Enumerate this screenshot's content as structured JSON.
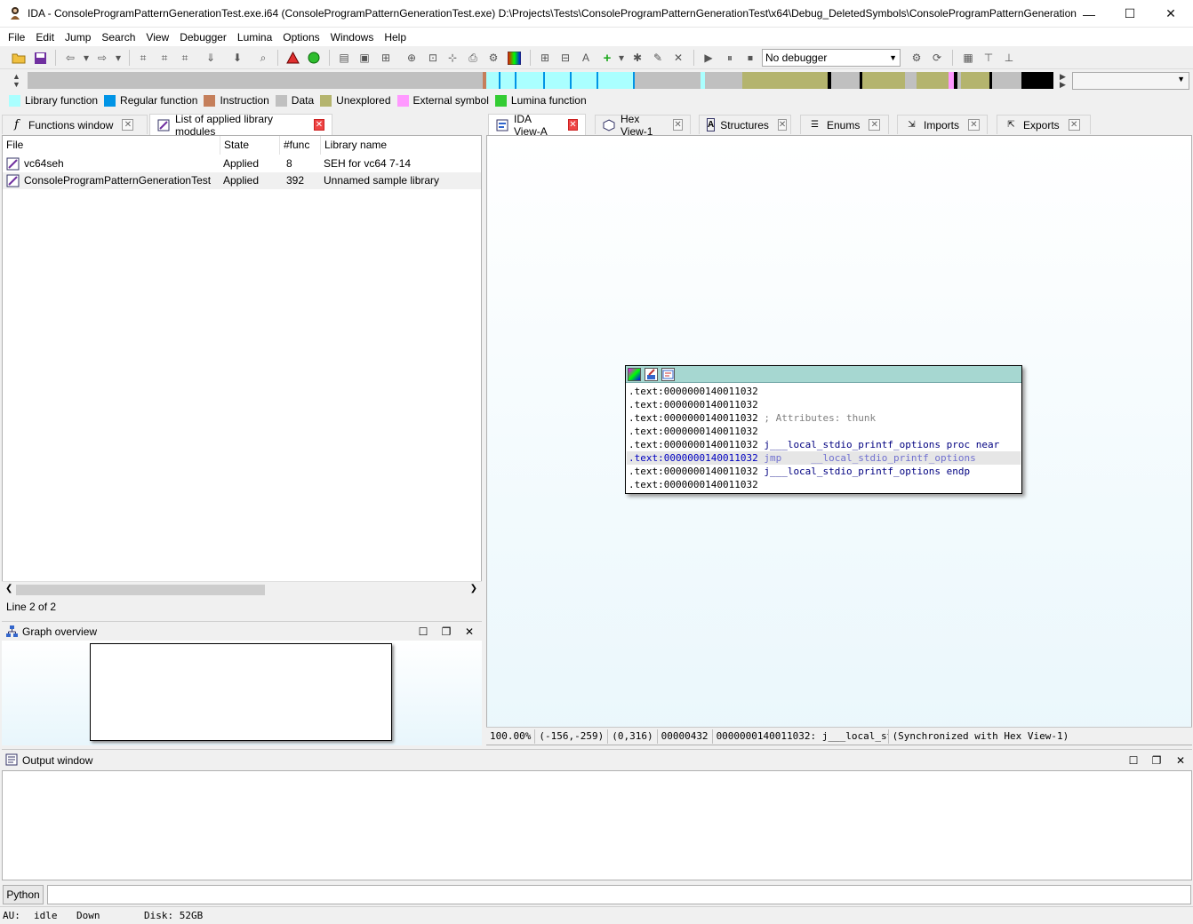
{
  "window": {
    "title": "IDA - ConsoleProgramPatternGenerationTest.exe.i64 (ConsoleProgramPatternGenerationTest.exe) D:\\Projects\\Tests\\ConsoleProgramPatternGenerationTest\\x64\\Debug_DeletedSymbols\\ConsoleProgramPatternGenerationT...",
    "minimize": "—",
    "maximize": "☐",
    "close": "✕"
  },
  "menu": [
    "File",
    "Edit",
    "Jump",
    "Search",
    "View",
    "Debugger",
    "Lumina",
    "Options",
    "Windows",
    "Help"
  ],
  "toolbar": {
    "debugger": "No debugger"
  },
  "legend": [
    {
      "label": "Library function",
      "color": "#aaffff"
    },
    {
      "label": "Regular function",
      "color": "#0094e6"
    },
    {
      "label": "Instruction",
      "color": "#c57f5b"
    },
    {
      "label": "Data",
      "color": "#c0c0c0"
    },
    {
      "label": "Unexplored",
      "color": "#b4b46e"
    },
    {
      "label": "External symbol",
      "color": "#ff99ff"
    },
    {
      "label": "Lumina function",
      "color": "#33cc33"
    }
  ],
  "left_tabs": [
    {
      "label": "Functions window",
      "icon": "function-icon"
    },
    {
      "label": "List of applied library modules",
      "icon": "library-icon"
    }
  ],
  "right_tabs": [
    {
      "label": "IDA View-A",
      "icon": "ida-view-icon"
    },
    {
      "label": "Hex View-1",
      "icon": "hex-view-icon"
    },
    {
      "label": "Structures",
      "icon": "structures-icon"
    },
    {
      "label": "Enums",
      "icon": "enums-icon"
    },
    {
      "label": "Imports",
      "icon": "imports-icon"
    },
    {
      "label": "Exports",
      "icon": "exports-icon"
    }
  ],
  "library_table": {
    "columns": [
      "File",
      "State",
      "#func",
      "Library name"
    ],
    "rows": [
      {
        "file": "vc64seh",
        "state": "Applied",
        "func": "8",
        "name": "SEH for vc64 7-14"
      },
      {
        "file": "ConsoleProgramPatternGenerationTest",
        "state": "Applied",
        "func": "392",
        "name": "Unnamed sample library"
      }
    ],
    "status": "Line 2 of 2"
  },
  "graph_overview": {
    "title": "Graph overview"
  },
  "code_lines": [
    {
      "addr": ".text:0000000140011032",
      "code": ""
    },
    {
      "addr": ".text:0000000140011032",
      "code": ""
    },
    {
      "addr": ".text:0000000140011032",
      "code": " ; Attributes: thunk"
    },
    {
      "addr": ".text:0000000140011032",
      "code": ""
    },
    {
      "addr": ".text:0000000140011032",
      "code": " j___local_stdio_printf_options proc near"
    },
    {
      "addr": ".text:0000000140011032",
      "code": " jmp     __local_stdio_printf_options"
    },
    {
      "addr": ".text:0000000140011032",
      "code": " j___local_stdio_printf_options endp"
    },
    {
      "addr": ".text:0000000140011032",
      "code": ""
    }
  ],
  "ida_status": [
    "100.00%",
    "(-156,-259)",
    "(0,316)",
    "00000432",
    "0000000140011032: j___local_stdio_printf_optio",
    "(Synchronized with Hex View-1)"
  ],
  "output": {
    "title": "Output window",
    "python": "Python"
  },
  "statusbar": {
    "au": "AU:",
    "state": "idle",
    "direction": "Down",
    "disk": "Disk: 52GB"
  }
}
